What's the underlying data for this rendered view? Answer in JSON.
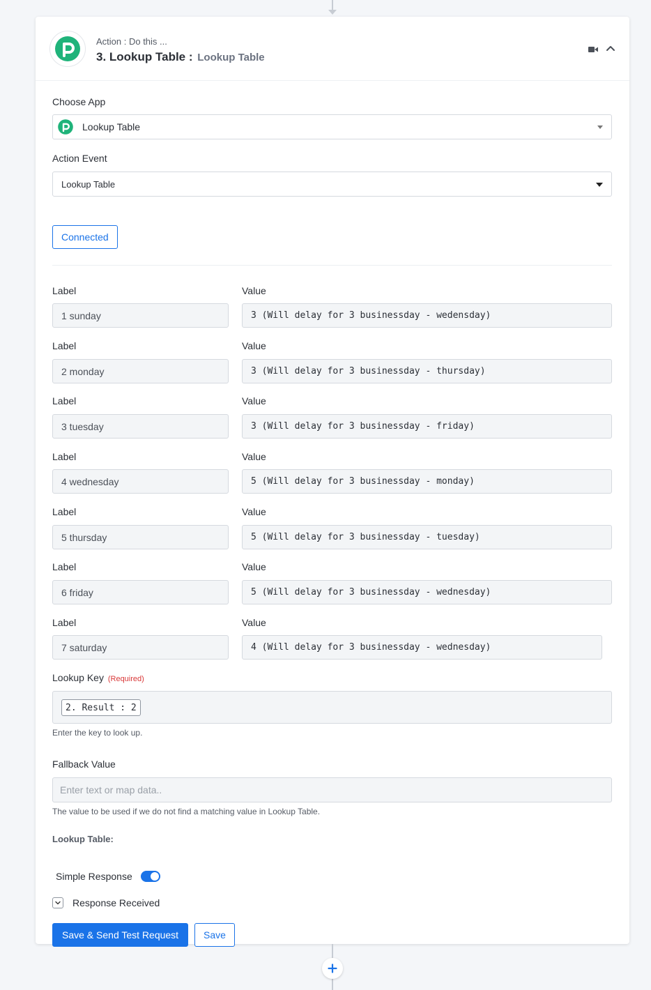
{
  "header": {
    "subtitle": "Action : Do this ...",
    "step_title": "3. Lookup Table :",
    "app_name": "Lookup Table"
  },
  "choose_app": {
    "label": "Choose App",
    "value": "Lookup Table"
  },
  "action_event": {
    "label": "Action Event",
    "value": "Lookup Table"
  },
  "connected_label": "Connected",
  "lookup_rows": [
    {
      "label_header": "Label",
      "value_header": "Value",
      "label": "1 sunday",
      "value": "3 (Will delay for 3 businessday - wedensday)"
    },
    {
      "label_header": "Label",
      "value_header": "Value",
      "label": "2 monday",
      "value": "3 (Will delay for 3 businessday - thursday)"
    },
    {
      "label_header": "Label",
      "value_header": "Value",
      "label": "3 tuesday",
      "value": "3 (Will delay for 3 businessday - friday)"
    },
    {
      "label_header": "Label",
      "value_header": "Value",
      "label": "4 wednesday",
      "value": "5 (Will delay for 3 businessday - monday)"
    },
    {
      "label_header": "Label",
      "value_header": "Value",
      "label": "5 thursday",
      "value": "5 (Will delay for 3 businessday - tuesday)"
    },
    {
      "label_header": "Label",
      "value_header": "Value",
      "label": "6 friday",
      "value": "5 (Will delay for 3 businessday - wednesday)"
    },
    {
      "label_header": "Label",
      "value_header": "Value",
      "label": "7 saturday",
      "value": "4 (Will delay for 3 businessday - wednesday)"
    }
  ],
  "lookup_key": {
    "label": "Lookup Key",
    "required": "(Required)",
    "pill": "2. Result : 2",
    "help": "Enter the key to look up."
  },
  "fallback": {
    "label": "Fallback Value",
    "placeholder": "Enter text or map data..",
    "help": "The value to be used if we do not find a matching value in Lookup Table."
  },
  "lookup_table_title": "Lookup Table:",
  "simple_response": {
    "label": "Simple Response",
    "enabled": true
  },
  "response_received": "Response Received",
  "buttons": {
    "save_send": "Save & Send Test Request",
    "save": "Save"
  },
  "colors": {
    "accent": "#1a73e8",
    "logo_green": "#1fb37a",
    "required_red": "#d93838"
  }
}
